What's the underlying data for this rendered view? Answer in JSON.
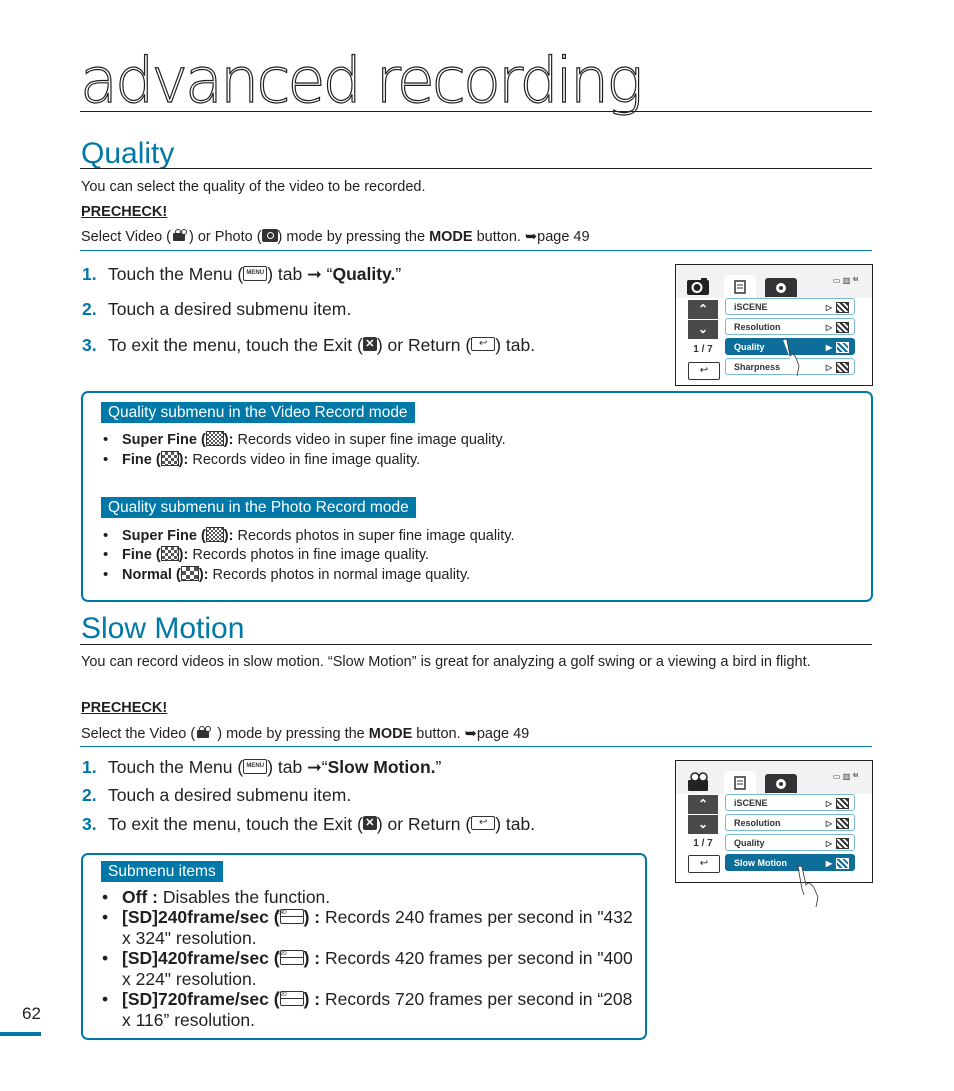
{
  "page": {
    "chapter_title": "advanced recording",
    "page_number": "62",
    "accent_color": "#0078a8"
  },
  "quality": {
    "heading": "Quality",
    "intro": "You can select the quality of the video to be recorded.",
    "precheck_label": "PRECHECK!",
    "precheck": {
      "before_video": "Select Video (",
      "between": ") or Photo (",
      "after_photo": ") mode by pressing the ",
      "mode_word": "MODE",
      "after_mode": " button. ",
      "page_ref": "➥page 49"
    },
    "steps": [
      {
        "num": "1.",
        "before": "Touch the Menu (",
        "menu_icon": "MENU",
        "after": ") tab ➞ “",
        "bold": "Quality.",
        "end": "”"
      },
      {
        "num": "2.",
        "text": "Touch a desired submenu item."
      },
      {
        "num": "3.",
        "before": "To exit the menu, touch the Exit (",
        "middle": ") or Return (",
        "after": ") tab."
      }
    ],
    "video_box": {
      "label": "Quality submenu in the Video Record mode",
      "items": [
        {
          "term": "Super Fine (",
          "term_end": "):",
          "desc": " Records video in super fine image quality.",
          "icon": "super-fine-icon"
        },
        {
          "term": "Fine (",
          "term_end": "):",
          "desc": " Records video in fine image quality.",
          "icon": "fine-icon"
        }
      ]
    },
    "photo_box": {
      "label": "Quality submenu in the Photo Record mode",
      "items": [
        {
          "term": "Super Fine (",
          "term_end": "):",
          "desc": " Records photos in super fine image quality.",
          "icon": "super-fine-icon"
        },
        {
          "term": "Fine (",
          "term_end": "):",
          "desc": " Records photos in fine image quality.",
          "icon": "fine-icon"
        },
        {
          "term": "Normal (",
          "term_end": "):",
          "desc": " Records photos in normal image quality.",
          "icon": "normal-icon"
        }
      ]
    },
    "screen": {
      "mode_icon": "camera-icon",
      "page_indicator": "1 / 7",
      "status": "▭ ▥ ⁱᴹ",
      "items": [
        {
          "label": "iSCENE",
          "selected": false
        },
        {
          "label": "Resolution",
          "selected": false
        },
        {
          "label": "Quality",
          "selected": true
        },
        {
          "label": "Sharpness",
          "selected": false
        }
      ]
    }
  },
  "slow_motion": {
    "heading": "Slow Motion",
    "intro": "You can record videos in slow motion. “Slow Motion” is great for analyzing a golf swing or a viewing a bird in flight.",
    "precheck_label": "PRECHECK!",
    "precheck": {
      "before_video": "Select the Video (",
      "after_video": " ) mode by pressing the ",
      "mode_word": "MODE",
      "after_mode": " button. ",
      "page_ref": "➥page 49"
    },
    "steps": [
      {
        "num": "1.",
        "before": "Touch the Menu (",
        "menu_icon": "MENU",
        "after": ") tab ➞“",
        "bold": "Slow Motion.",
        "end": "”"
      },
      {
        "num": "2.",
        "text": "Touch a desired submenu item."
      },
      {
        "num": "3.",
        "before": "To exit the menu, touch the Exit (",
        "middle": ") or Return (",
        "after": ") tab."
      }
    ],
    "submenu_box": {
      "label": "Submenu items",
      "items": [
        {
          "term": "Off :",
          "desc": " Disables the function."
        },
        {
          "term": "[SD]240frame/sec (",
          "icon_text": "240",
          "term_end": ") :",
          "desc": " Records 240 frames per second in \"432 x 324\" resolution."
        },
        {
          "term": "[SD]420frame/sec (",
          "icon_text": "420",
          "term_end": ") :",
          "desc": " Records 420 frames per second in \"400 x 224\" resolution."
        },
        {
          "term": "[SD]720frame/sec (",
          "icon_text": "720",
          "term_end": ") :",
          "desc": " Records 720 frames per second in “208 x 116” resolution."
        }
      ]
    },
    "screen": {
      "mode_icon": "video-camera-icon",
      "page_indicator": "1 / 7",
      "status": "▭ ▥ ⁱᴹ",
      "items": [
        {
          "label": "iSCENE",
          "selected": false
        },
        {
          "label": "Resolution",
          "selected": false
        },
        {
          "label": "Quality",
          "selected": false
        },
        {
          "label": "Slow Motion",
          "selected": true
        }
      ]
    }
  }
}
